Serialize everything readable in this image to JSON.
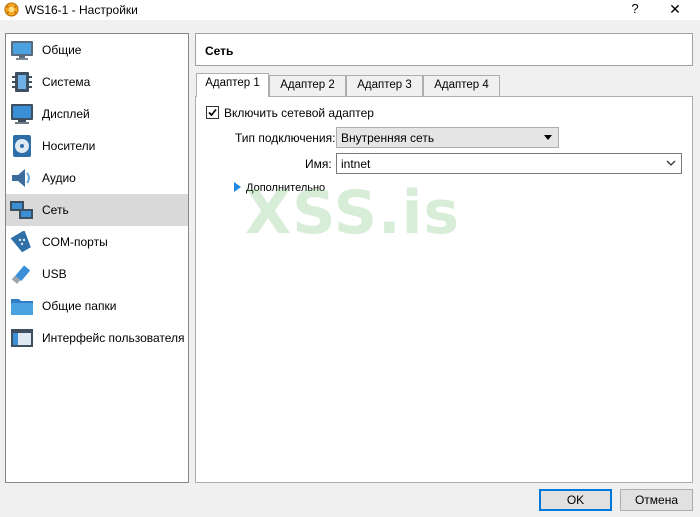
{
  "window": {
    "title": "WS16-1 - Настройки",
    "help_label": "?",
    "close_label": "✕"
  },
  "sidebar": {
    "items": [
      {
        "label": "Общие",
        "icon": "general-monitor-icon",
        "selected": false
      },
      {
        "label": "Система",
        "icon": "system-chip-icon",
        "selected": false
      },
      {
        "label": "Дисплей",
        "icon": "display-monitor-icon",
        "selected": false
      },
      {
        "label": "Носители",
        "icon": "storage-disc-icon",
        "selected": false
      },
      {
        "label": "Аудио",
        "icon": "audio-speaker-icon",
        "selected": false
      },
      {
        "label": "Сеть",
        "icon": "network-icon",
        "selected": true
      },
      {
        "label": "COM-порты",
        "icon": "serial-port-icon",
        "selected": false
      },
      {
        "label": "USB",
        "icon": "usb-icon",
        "selected": false
      },
      {
        "label": "Общие папки",
        "icon": "shared-folder-icon",
        "selected": false
      },
      {
        "label": "Интерфейс пользователя",
        "icon": "user-interface-icon",
        "selected": false
      }
    ]
  },
  "section": {
    "title": "Сеть"
  },
  "tabs": [
    {
      "label": "Адаптер 1",
      "active": true
    },
    {
      "label": "Адаптер 2",
      "active": false
    },
    {
      "label": "Адаптер 3",
      "active": false
    },
    {
      "label": "Адаптер 4",
      "active": false
    }
  ],
  "adapter": {
    "enable_label": "Включить сетевой адаптер",
    "enabled": true,
    "attachment_label": "Тип подключения:",
    "attachment_value": "Внутренняя сеть",
    "name_label": "Имя:",
    "name_value": "intnet",
    "advanced_label": "Дополнительно"
  },
  "watermark": "XSS.is",
  "buttons": {
    "ok": "OK",
    "cancel": "Отмена"
  },
  "colors": {
    "selection": "#d9d9d9",
    "accent": "#0078d7",
    "advanced_arrow": "#1e88e5"
  }
}
